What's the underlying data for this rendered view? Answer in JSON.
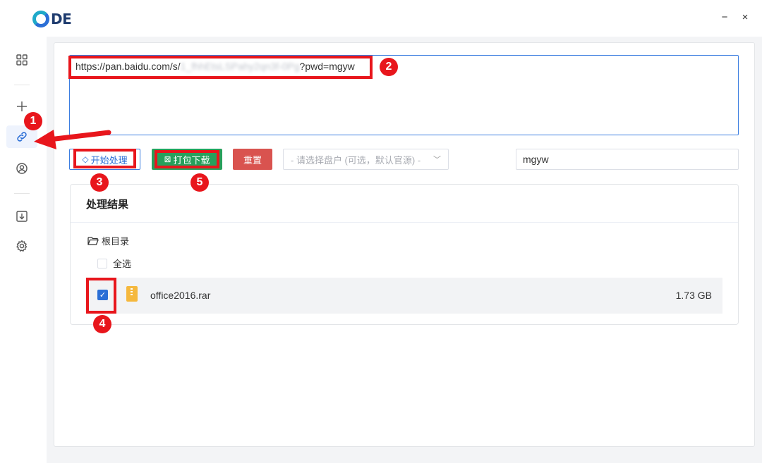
{
  "app": {
    "logo_text": "DE"
  },
  "window": {
    "minimize": "−",
    "close": "×"
  },
  "sidebar": {
    "items": [
      {
        "icon": "apps-grid-icon"
      },
      {
        "icon": "plus-icon"
      },
      {
        "icon": "link-icon",
        "active": true
      },
      {
        "icon": "user-icon"
      },
      {
        "icon": "download-icon"
      },
      {
        "icon": "gear-icon"
      }
    ]
  },
  "url_input": {
    "prefix": "https://pan.baidu.com/s/",
    "redacted": "1_fhhEtsLSPahy2qn3f-0Pg",
    "suffix": "?pwd=mgyw"
  },
  "toolbar": {
    "start_label": "开始处理",
    "pack_label": "打包下载",
    "reset_label": "重置",
    "disk_placeholder": "- 请选择盘户 (可选，默认官源) -",
    "password_value": "mgyw"
  },
  "results": {
    "title": "处理结果",
    "root_label": "根目录",
    "select_all_label": "全选",
    "files": [
      {
        "name": "office2016.rar",
        "size": "1.73 GB",
        "checked": true
      }
    ]
  },
  "annotations": [
    "1",
    "2",
    "3",
    "4",
    "5"
  ],
  "colors": {
    "accent": "#2b6fd6",
    "pack_green": "#27a05c",
    "reset_red": "#d9534f",
    "annotation_red": "#e8161c"
  }
}
